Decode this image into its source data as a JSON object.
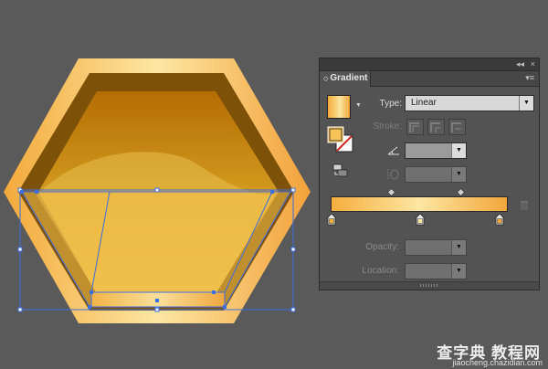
{
  "panel": {
    "tab_label": "Gradient",
    "tab_arrows": "◇",
    "collapse_icon": "◂◂",
    "close_icon": "×",
    "menu_icon": "▾≡",
    "type_label": "Type:",
    "type_value": "Linear",
    "stroke_label": "Stroke:",
    "angle_value": "",
    "aspect_value": "",
    "opacity_label": "Opacity:",
    "opacity_value": "",
    "location_label": "Location:",
    "location_value": "",
    "dropdown_caret": "▼",
    "swatch_caret": "▼"
  },
  "gradient": {
    "stops": [
      {
        "location": 0,
        "color": "#f6ae3e"
      },
      {
        "location": 50,
        "color": "#fde7a3"
      },
      {
        "location": 100,
        "color": "#f2a63b"
      }
    ],
    "midpoints": [
      25,
      75
    ]
  },
  "colors": {
    "background": "#5a5a5a",
    "panel": "#535353",
    "selection": "#3d6fe0",
    "gold_light": "#fde7a3",
    "gold_dark": "#b86d00"
  },
  "icons": [
    "collapse-icon",
    "close-icon",
    "panel-menu-icon",
    "angle-icon",
    "aspect-ratio-icon",
    "reverse-gradient-icon",
    "trash-icon"
  ],
  "watermark": {
    "chinese": "查字典 教程网",
    "url": "jiaocheng.chazidian.com"
  }
}
